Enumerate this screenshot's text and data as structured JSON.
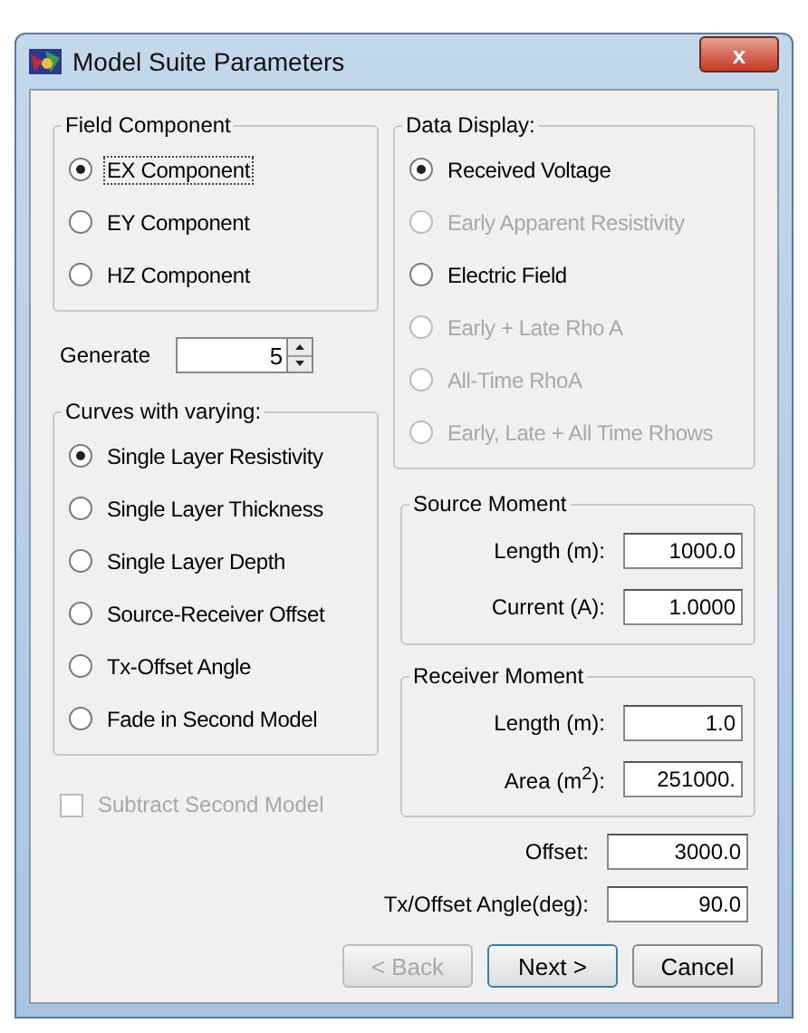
{
  "window": {
    "title": "Model Suite Parameters",
    "close": "x"
  },
  "field_component": {
    "title": "Field Component",
    "options": [
      {
        "label": "EX Component",
        "selected": true,
        "focused": true
      },
      {
        "label": "EY Component",
        "selected": false,
        "focused": false
      },
      {
        "label": "HZ Component",
        "selected": false,
        "focused": false
      }
    ]
  },
  "generate": {
    "label": "Generate",
    "value": "5"
  },
  "curves": {
    "title": "Curves with varying:",
    "options": [
      {
        "label": "Single Layer Resistivity",
        "selected": true
      },
      {
        "label": "Single Layer Thickness",
        "selected": false
      },
      {
        "label": "Single Layer Depth",
        "selected": false
      },
      {
        "label": "Source-Receiver Offset",
        "selected": false
      },
      {
        "label": "Tx-Offset Angle",
        "selected": false
      },
      {
        "label": "Fade in Second Model",
        "selected": false
      }
    ]
  },
  "subtract": {
    "label": "Subtract Second Model",
    "checked": false,
    "disabled": true
  },
  "data_display": {
    "title": "Data Display:",
    "options": [
      {
        "label": "Received Voltage",
        "selected": true,
        "disabled": false
      },
      {
        "label": "Early Apparent Resistivity",
        "selected": false,
        "disabled": true
      },
      {
        "label": "Electric Field",
        "selected": false,
        "disabled": false
      },
      {
        "label": "Early + Late Rho A",
        "selected": false,
        "disabled": true
      },
      {
        "label": "All-Time RhoA",
        "selected": false,
        "disabled": true
      },
      {
        "label": "Early, Late + All Time Rhows",
        "selected": false,
        "disabled": true
      }
    ]
  },
  "source_moment": {
    "title": "Source Moment",
    "fields": [
      {
        "label": "Length (m):",
        "value": "1000.0"
      },
      {
        "label": "Current (A):",
        "value": "1.0000"
      }
    ]
  },
  "receiver_moment": {
    "title": "Receiver Moment",
    "fields": [
      {
        "label": "Length (m):",
        "value": "1.0"
      },
      {
        "label": "Area (m$^{2}$):",
        "value": "251000."
      }
    ]
  },
  "geometry": [
    {
      "label": "Offset:",
      "value": "3000.0"
    },
    {
      "label": "Tx/Offset Angle(deg):",
      "value": "90.0"
    }
  ],
  "buttons": [
    {
      "label": "< Back",
      "disabled": true,
      "default": false
    },
    {
      "label": "Next >",
      "disabled": false,
      "default": true
    },
    {
      "label": "Cancel",
      "disabled": false,
      "default": false
    }
  ]
}
